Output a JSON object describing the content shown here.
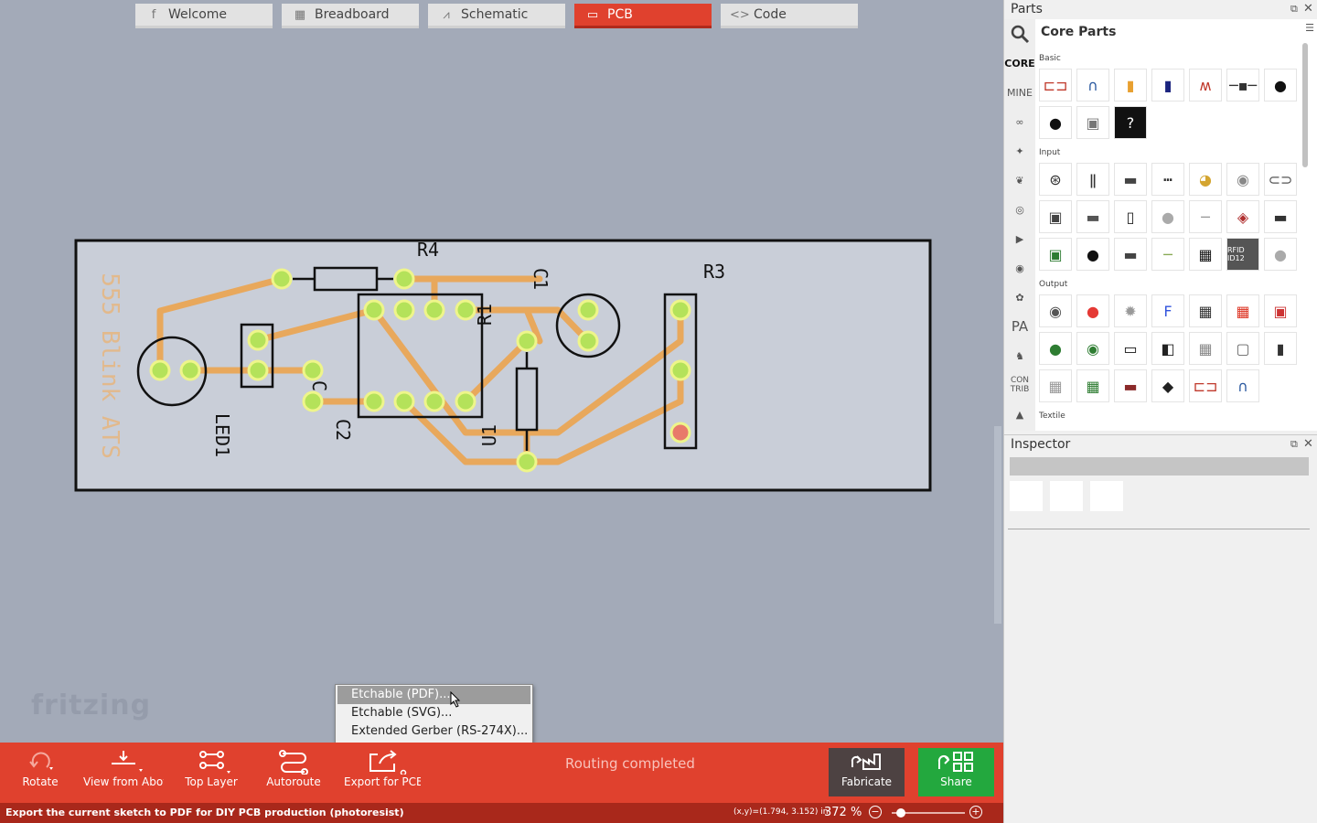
{
  "tabs": [
    {
      "label": "Welcome",
      "icon": "fritzing-f-icon"
    },
    {
      "label": "Breadboard",
      "icon": "breadboard-icon"
    },
    {
      "label": "Schematic",
      "icon": "schematic-icon"
    },
    {
      "label": "PCB",
      "icon": "pcb-icon",
      "active": true
    },
    {
      "label": "Code",
      "icon": "code-icon"
    }
  ],
  "pcb": {
    "labels": {
      "r4": "R4",
      "r3": "R3",
      "r1": "R1",
      "c1": "C1",
      "c2": "C2",
      "u1": "U1",
      "led1": "LED1",
      "c": "C",
      "board_text": "555 Blink ATS"
    },
    "colors": {
      "board": "#c9ced8",
      "trace": "#e8a85c",
      "pad": "#b4e25a",
      "pad_ring": "#eef58a",
      "silk": "#111111",
      "board_text": "#e2b98c"
    }
  },
  "watermark": "fritzing",
  "context_menu": {
    "items": [
      "Etchable (PDF)...",
      "Etchable (SVG)...",
      "Extended Gerber (RS-274X)..."
    ],
    "selected_index": 0
  },
  "toolbar": {
    "rotate": "Rotate",
    "view": "View from Above",
    "layer": "Top Layer",
    "autoroute": "Autoroute",
    "export": "Export for PCB",
    "routing_status": "Routing completed",
    "fabricate": "Fabricate",
    "share": "Share"
  },
  "status": {
    "message": "Export the current sketch to PDF for DIY PCB production (photoresist)",
    "coords": "(x,y)=(1.794, 3.152) in",
    "zoom": "372",
    "zoom_unit": "%"
  },
  "parts": {
    "title": "Parts",
    "bin_title": "Core Parts",
    "bins": [
      "CORE",
      "MINE",
      "arduino",
      "sparkfun",
      "seeed",
      "intel",
      "snootlab",
      "lilypad",
      "adafruit",
      "PA",
      "animal",
      "CON TRIB"
    ],
    "sections": {
      "basic": "Basic",
      "input": "Input",
      "output": "Output",
      "textile": "Textile"
    },
    "rfid_label": "RFID ID12"
  },
  "inspector": {
    "title": "Inspector"
  }
}
